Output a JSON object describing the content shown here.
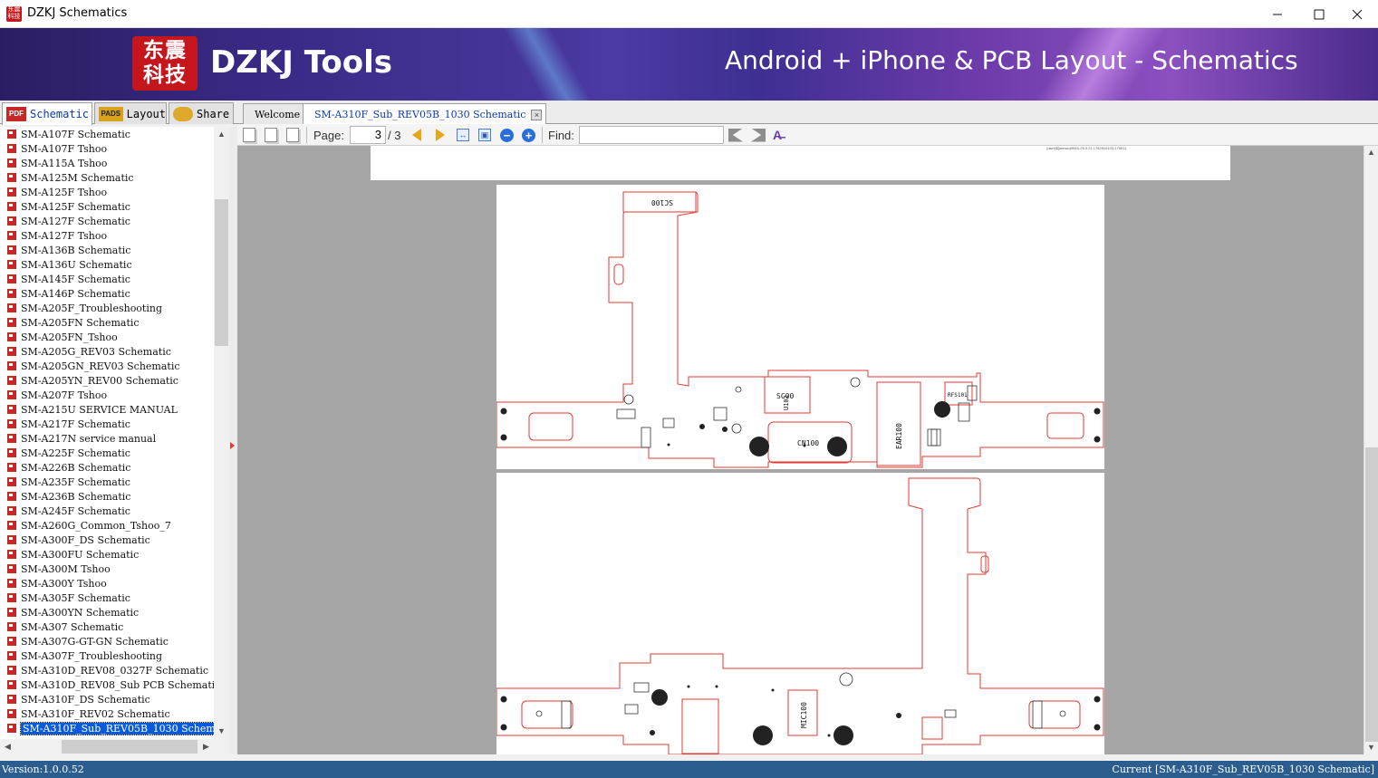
{
  "window": {
    "title": "DZKJ Schematics",
    "icon_text": "东震科技"
  },
  "banner": {
    "logo_text": "东震科技",
    "brand": "DZKJ Tools",
    "tagline": "Android + iPhone & PCB Layout - Schematics"
  },
  "left_tabs": [
    {
      "label": "Schematic",
      "icon": "PDF"
    },
    {
      "label": "Layout",
      "icon": "PADS"
    },
    {
      "label": "Share",
      "icon": "share-icon"
    }
  ],
  "files": [
    "SM-A107F Schematic",
    "SM-A107F Tshoo",
    "SM-A115A Tshoo",
    "SM-A125M Schematic",
    "SM-A125F Tshoo",
    "SM-A125F Schematic",
    "SM-A127F Schematic",
    "SM-A127F Tshoo",
    "SM-A136B Schematic",
    "SM-A136U Schematic",
    "SM-A145F Schematic",
    "SM-A146P Schematic",
    "SM-A205F_Troubleshooting",
    "SM-A205FN Schematic",
    "SM-A205FN_Tshoo",
    "SM-A205G_REV03 Schematic",
    "SM-A205GN_REV03 Schematic",
    "SM-A205YN_REV00 Schematic",
    "SM-A207F Tshoo",
    "SM-A215U SERVICE MANUAL",
    "SM-A217F Schematic",
    "SM-A217N service manual",
    "SM-A225F Schematic",
    "SM-A226B Schematic",
    "SM-A235F Schematic",
    "SM-A236B Schematic",
    "SM-A245F Schematic",
    "SM-A260G_Common_Tshoo_7",
    "SM-A300F_DS Schematic",
    "SM-A300FU Schematic",
    "SM-A300M Tshoo",
    "SM-A300Y Tshoo",
    "SM-A305F Schematic",
    "SM-A300YN Schematic",
    "SM-A307 Schematic",
    "SM-A307G-GT-GN Schematic",
    "SM-A307F_Troubleshooting",
    "SM-A310D_REV08_0327F Schematic",
    "SM-A310D_REV08_Sub PCB Schematic",
    "SM-A310F_DS Schematic",
    "SM-A310F_REV02 Schematic",
    "SM-A310F_Sub_REV05B_1030 Schematic"
  ],
  "selected_file": "SM-A310F_Sub_REV05B_1030 Schematic",
  "doc_tabs": [
    {
      "label": "Welcome"
    },
    {
      "label": "SM-A310F_Sub_REV05B_1030 Schematic",
      "close": "×"
    }
  ],
  "toolbar": {
    "page_label": "Page:",
    "page_value": "3",
    "page_total": "/ 3",
    "find_label": "Find:",
    "find_value": ""
  },
  "pcb_labels": {
    "top_connector": "SC100",
    "ic": "U102",
    "ic_sub": "SC00",
    "usb": "CN100",
    "earjack": "EAR100",
    "rf": "RFS101",
    "mic": "MIC100",
    "bottom_center": "MIC100",
    "header_text": "(user)$(semco)9610-25.3.21 1762910103-176511"
  },
  "status": {
    "version": "Version:1.0.0.52",
    "current": "Current [SM-A310F_Sub_REV05B_1030 Schematic]"
  },
  "colors": {
    "accent": "#0a5bd8",
    "statusbar": "#2b5d8f",
    "pcb_outline": "#e53935"
  }
}
